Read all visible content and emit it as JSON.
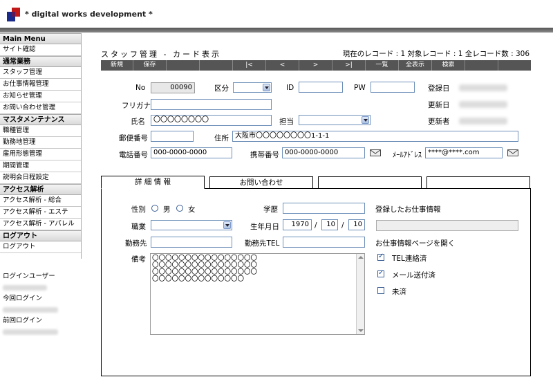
{
  "app": {
    "title": "* digital works development *"
  },
  "sidebar": {
    "sections": [
      {
        "title": "Main Menu",
        "items": [
          "サイト確認"
        ]
      },
      {
        "title": "通常業務",
        "items": [
          "スタッフ管理",
          "お仕事情報管理",
          "お知らせ管理",
          "お問い合わせ管理"
        ]
      },
      {
        "title": "マスタメンテナンス",
        "items": [
          "職種管理",
          "勤務地管理",
          "雇用形態管理",
          "期間管理",
          "説明会日程設定"
        ]
      },
      {
        "title": "アクセス解析",
        "items": [
          "アクセス解析 - 総合",
          "アクセス解析 - エステ",
          "アクセス解析 - アパレル"
        ]
      },
      {
        "title": "ログアウト",
        "items": [
          "ログアウト"
        ]
      }
    ],
    "login": {
      "user_label": "ログインユーザー",
      "current_label": "今回ログイン",
      "previous_label": "前回ログイン"
    }
  },
  "page": {
    "heading": "スタッフ管理 - カード表示",
    "record_status": "現在のレコード : 1  対象レコード : 1  全レコード数 : 306"
  },
  "toolbar": [
    "新規",
    "保存",
    "",
    "",
    "|<",
    "<",
    ">",
    ">|",
    "一覧",
    "全表示",
    "検索",
    "",
    ""
  ],
  "form": {
    "no_label": "No",
    "no_value": "00090",
    "kubun_label": "区分",
    "id_label": "ID",
    "pw_label": "PW",
    "registered_label": "登録日",
    "updated_label": "更新日",
    "updater_label": "更新者",
    "furigana_label": "フリガナ",
    "name_label": "氏名",
    "name_value": "〇〇〇〇〇〇〇〇",
    "tanto_label": "担当",
    "postal_label": "郵便番号",
    "address_label": "住所",
    "address_value": "大阪市〇〇〇〇〇〇〇〇1-1-1",
    "phone_label": "電話番号",
    "phone_value": "000-0000-0000",
    "mobile_label": "携帯番号",
    "mobile_value": "000-0000-0000",
    "mail_label": "ﾒｰﾙｱﾄﾞﾚｽ",
    "mail_value": "****@****.com"
  },
  "tabs": [
    "詳 細 情 報",
    "お問い合わせ",
    "",
    ""
  ],
  "detail": {
    "gender_label": "性別",
    "male": "男",
    "female": "女",
    "education_label": "学歴",
    "job_label": "職業",
    "birth_label": "生年月日",
    "birth_year": "1970",
    "birth_month": "10",
    "birth_day": "10",
    "date_sep": "/",
    "workplace_label": "勤務先",
    "workplace_tel_label": "勤務先TEL",
    "notes_label": "備考",
    "notes_value": "〇〇〇〇〇〇〇〇〇〇〇〇〇〇〇〇〇〇〇〇〇〇〇〇〇〇〇〇〇〇〇〇〇〇〇〇〇〇〇〇〇〇〇〇〇〇〇〇〇〇〇〇〇〇〇〇〇〇〇〇〇〇",
    "registered_jobs_label": "登録したお仕事情報",
    "open_jobs_link": "お仕事情報ページを開く",
    "checks": [
      {
        "label": "TEL連絡済",
        "checked": true
      },
      {
        "label": "メール送付済",
        "checked": true
      },
      {
        "label": "未済",
        "checked": false
      }
    ]
  }
}
